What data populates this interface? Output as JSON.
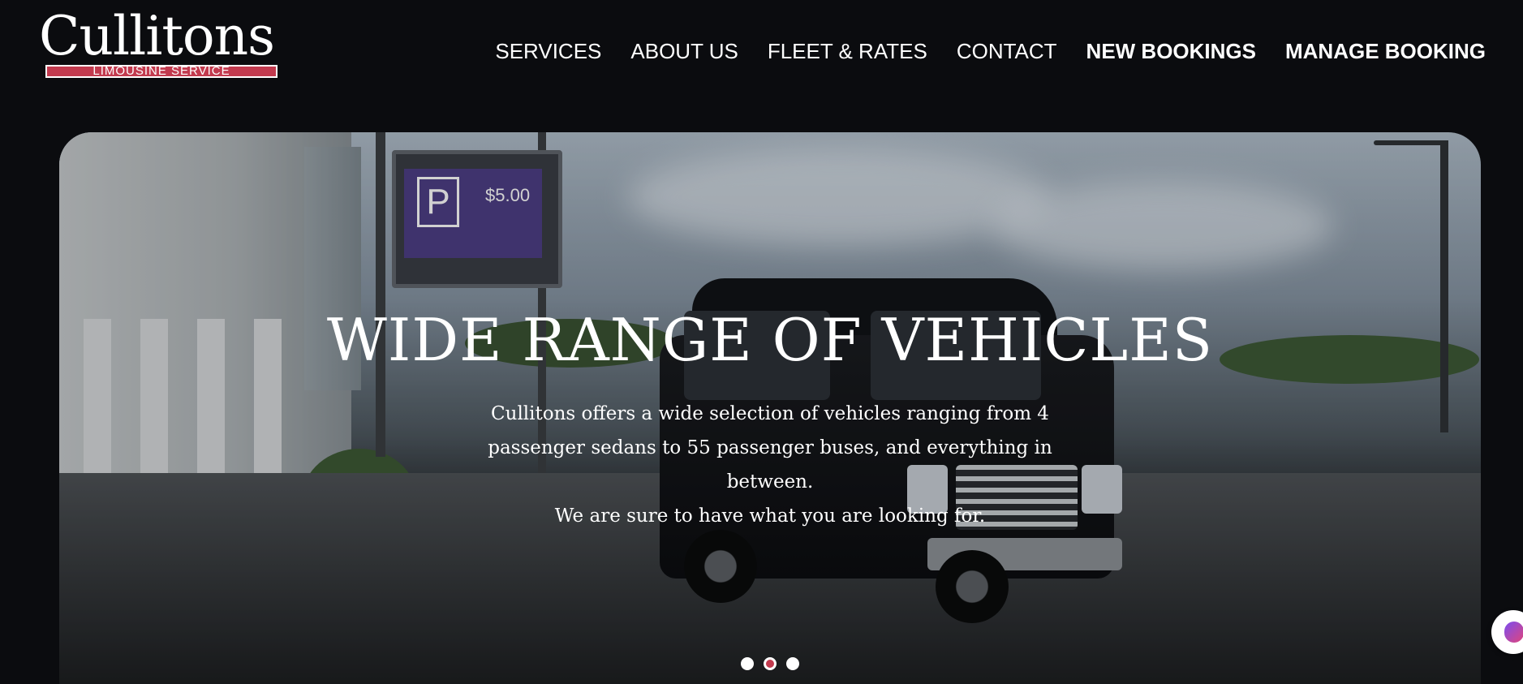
{
  "brand": {
    "name": "Cullitons",
    "tagline": "LIMOUSINE SERVICE",
    "accent_color": "#c23a4e"
  },
  "nav": {
    "items": [
      {
        "label": "SERVICES",
        "bold": false
      },
      {
        "label": "ABOUT US",
        "bold": false
      },
      {
        "label": "FLEET & RATES",
        "bold": false
      },
      {
        "label": "CONTACT",
        "bold": false
      },
      {
        "label": "NEW BOOKINGS",
        "bold": true
      },
      {
        "label": "MANAGE BOOKING",
        "bold": true
      }
    ]
  },
  "hero": {
    "title": "WIDE RANGE OF VEHICLES",
    "lines": [
      "Cullitons offers a wide selection of vehicles ranging from 4",
      "passenger sedans to 55 passenger buses, and everything in between.",
      "We are sure to have what you are looking for."
    ],
    "sign_price": "$5.00",
    "sign_letter": "P",
    "slides": 3,
    "active_slide": 2
  },
  "widget": {
    "icon": "brain-icon"
  }
}
